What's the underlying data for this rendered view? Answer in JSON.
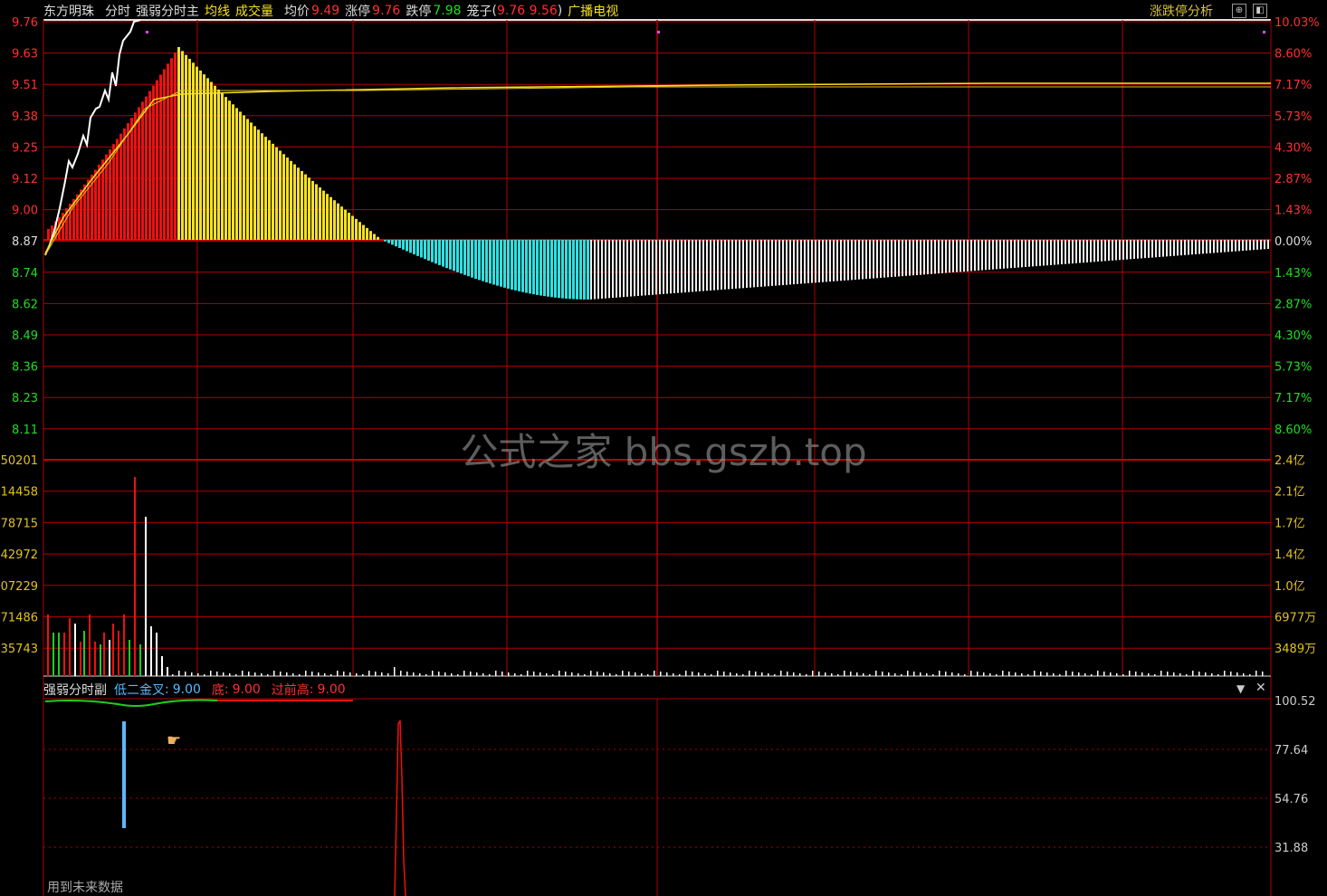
{
  "header": {
    "stock_name": "东方明珠",
    "mode": "分时",
    "indicator_name": "强弱分时主",
    "avg_line_label": "均线",
    "volume_label": "成交量",
    "avg_price_label": "均价",
    "avg_price_value": "9.49",
    "limit_up_label": "涨停",
    "limit_up_value": "9.76",
    "limit_down_label": "跌停",
    "limit_down_value": "7.98",
    "cage_label": "笼子",
    "cage_open": "(",
    "cage_value1": "9.76",
    "cage_value2": "9.56",
    "cage_close": ")",
    "sector": "广播电视",
    "analysis_button": "涨跌停分析",
    "restore_icon": "restore-icon",
    "maximize_icon": "maximize-icon"
  },
  "price_axis": {
    "left_labels": [
      "9.76",
      "9.63",
      "9.51",
      "9.38",
      "9.25",
      "9.12",
      "9.00",
      "8.87",
      "8.74",
      "8.62",
      "8.49",
      "8.36",
      "8.23",
      "8.11"
    ],
    "right_labels": [
      "10.03%",
      "8.60%",
      "7.17%",
      "5.73%",
      "4.30%",
      "2.87%",
      "1.43%",
      "0.00%",
      "1.43%",
      "2.87%",
      "4.30%",
      "5.73%",
      "7.17%",
      "8.60%"
    ]
  },
  "volume_axis": {
    "left_labels": [
      "50201",
      "14458",
      "78715",
      "42972",
      "07229",
      "71486",
      "35743"
    ],
    "right_labels": [
      "2.4亿",
      "2.1亿",
      "1.7亿",
      "1.4亿",
      "1.0亿",
      "6977万",
      "3489万"
    ]
  },
  "sub_panel": {
    "title": "强弱分时副",
    "golden_cross_label": "低二金叉",
    "golden_cross_sep": ":",
    "golden_cross_value": "9.00",
    "bottom_label": "底",
    "bottom_sep": ":",
    "bottom_value": "9.00",
    "prev_high_label": "过前高",
    "prev_high_sep": ":",
    "prev_high_value": "9.00",
    "axis_labels": [
      "100.52",
      "77.64",
      "54.76",
      "31.88"
    ],
    "dropdown_icon": "dropdown-icon",
    "close_icon": "close-icon",
    "footer_note": "用到未来数据"
  },
  "watermark": "公式之家 bbs.gszb.top",
  "colors": {
    "up": "#ff2020",
    "down": "#22dd22",
    "yellow": "#f5e020",
    "cyan": "#30e0e0",
    "grid": "#b00000",
    "axis_text_up": "#ff3030",
    "axis_text_down": "#20dd20",
    "volume_text": "#e0c020"
  }
}
